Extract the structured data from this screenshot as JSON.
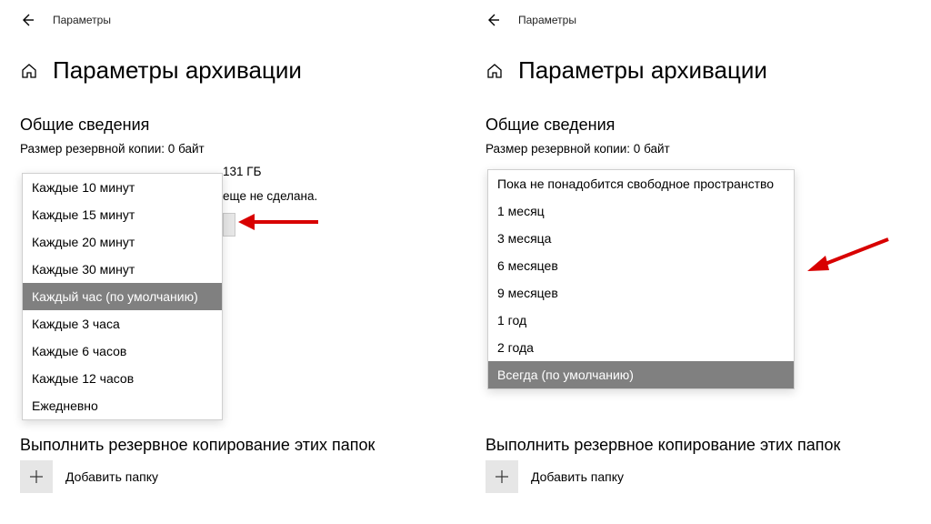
{
  "colors": {
    "accent": "#808080",
    "arrow": "#d80000"
  },
  "window_name": "Параметры",
  "page_title": "Параметры архивации",
  "overview": {
    "header": "Общие сведения",
    "backup_size": "Размер резервной копии: 0 байт",
    "drive_line_fragment": "131 ГБ",
    "not_done_fragment": "еще не сделана."
  },
  "folders": {
    "title_full": "Выполнить резервное копирование этих папок",
    "title_partial_left": "Выполнить резервное копирование этих папок",
    "add_label": "Добавить папку"
  },
  "left_dropdown": {
    "selected_index": 4,
    "items": [
      "Каждые 10 минут",
      "Каждые 15 минут",
      "Каждые 20 минут",
      "Каждые 30 минут",
      "Каждый час (по умолчанию)",
      "Каждые 3 часа",
      "Каждые 6 часов",
      "Каждые 12 часов",
      "Ежедневно"
    ]
  },
  "right_dropdown": {
    "selected_index": 7,
    "items": [
      "Пока не понадобится свободное пространство",
      "1 месяц",
      "3 месяца",
      "6 месяцев",
      "9 месяцев",
      "1 год",
      "2 года",
      "Всегда (по умолчанию)"
    ]
  }
}
